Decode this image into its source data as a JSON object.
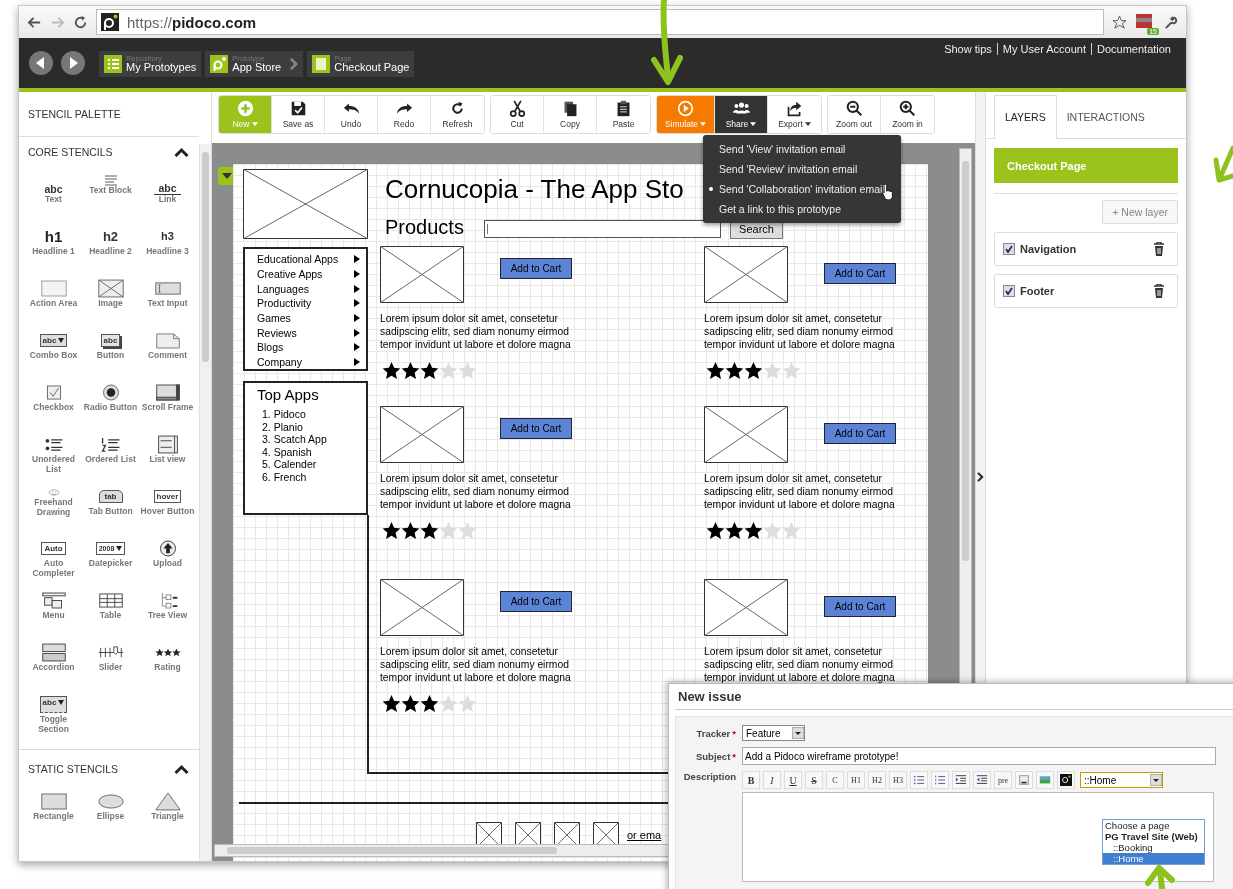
{
  "browser": {
    "url": "https://**pidoco.com**",
    "badge": "15"
  },
  "header": {
    "breadcrumbs": [
      {
        "caption": "Repository",
        "label": "My Prototypes"
      },
      {
        "caption": "Prototype",
        "label": "App Store"
      },
      {
        "caption": "Page",
        "label": "Checkout Page"
      }
    ],
    "links": [
      "Show tips",
      "My User Account",
      "Documentation"
    ]
  },
  "palette": {
    "title": "STENCIL PALETTE",
    "sections": [
      {
        "title": "CORE STENCILS",
        "expanded": true,
        "items": [
          {
            "label": "Text",
            "kind": "text",
            "glyph": "abc"
          },
          {
            "label": "Text Block",
            "kind": "textblock"
          },
          {
            "label": "Link",
            "kind": "link",
            "glyph": "abc"
          },
          {
            "label": "Headline 1",
            "kind": "h1",
            "glyph": "h1"
          },
          {
            "label": "Headline 2",
            "kind": "h2",
            "glyph": "h2"
          },
          {
            "label": "Headline 3",
            "kind": "h3",
            "glyph": "h3"
          },
          {
            "label": "Action Area",
            "kind": "area"
          },
          {
            "label": "Image",
            "kind": "image"
          },
          {
            "label": "Text Input",
            "kind": "input"
          },
          {
            "label": "Combo Box",
            "kind": "combo",
            "glyph": "abc"
          },
          {
            "label": "Button",
            "kind": "button",
            "glyph": "abc"
          },
          {
            "label": "Comment",
            "kind": "comment"
          },
          {
            "label": "Checkbox",
            "kind": "checkbox"
          },
          {
            "label": "Radio Button",
            "kind": "radio"
          },
          {
            "label": "Scroll Frame",
            "kind": "scroll"
          },
          {
            "label": "Unordered List",
            "kind": "ulist"
          },
          {
            "label": "Ordered List",
            "kind": "olist"
          },
          {
            "label": "List view",
            "kind": "listview"
          },
          {
            "label": "Freehand Drawing",
            "kind": "freehand"
          },
          {
            "label": "Tab Button",
            "kind": "tab",
            "glyph": "tab"
          },
          {
            "label": "Hover Button",
            "kind": "hover",
            "glyph": "hover"
          },
          {
            "label": "Auto Completer",
            "kind": "auto",
            "glyph": "Auto"
          },
          {
            "label": "Datepicker",
            "kind": "datepicker",
            "glyph": "2008"
          },
          {
            "label": "Upload",
            "kind": "upload"
          },
          {
            "label": "Menu",
            "kind": "menu"
          },
          {
            "label": "Table",
            "kind": "table"
          },
          {
            "label": "Tree View",
            "kind": "tree"
          },
          {
            "label": "Accordion",
            "kind": "accordion"
          },
          {
            "label": "Slider",
            "kind": "slider"
          },
          {
            "label": "Rating",
            "kind": "rating"
          },
          {
            "label": "Toggle Section",
            "kind": "toggle",
            "glyph": "abc"
          }
        ]
      },
      {
        "title": "STATIC STENCILS",
        "expanded": true,
        "items": [
          {
            "label": "Rectangle",
            "kind": "rect"
          },
          {
            "label": "Ellipse",
            "kind": "ellipse"
          },
          {
            "label": "Triangle",
            "kind": "triangle"
          }
        ]
      }
    ]
  },
  "toolbar": {
    "groups": [
      [
        {
          "label": "New",
          "dropdown": true,
          "selected": false
        },
        {
          "label": "Save as",
          "dropdown": false,
          "selected": false
        },
        {
          "label": "Undo",
          "dropdown": false,
          "selected": false
        },
        {
          "label": "Redo",
          "dropdown": false,
          "selected": false
        },
        {
          "label": "Refresh",
          "dropdown": false,
          "selected": false
        }
      ],
      [
        {
          "label": "Cut",
          "dropdown": false,
          "selected": false
        },
        {
          "label": "Copy",
          "dropdown": false,
          "selected": false
        },
        {
          "label": "Paste",
          "dropdown": false,
          "selected": false
        }
      ],
      [
        {
          "label": "Simulate",
          "dropdown": true,
          "selected": false
        },
        {
          "label": "Share",
          "dropdown": true,
          "selected": true
        },
        {
          "label": "Export",
          "dropdown": true,
          "selected": false
        }
      ],
      [
        {
          "label": "Zoom out",
          "dropdown": false,
          "selected": false
        },
        {
          "label": "Zoom in",
          "dropdown": false,
          "selected": false
        }
      ]
    ]
  },
  "share_menu": [
    {
      "label": "Send 'View' invitation email",
      "selected": false
    },
    {
      "label": "Send 'Review' invitation email",
      "selected": false
    },
    {
      "label": "Send 'Collaboration' invitation email",
      "selected": true
    },
    {
      "label": "Get a link to this prototype",
      "selected": false
    }
  ],
  "canvas": {
    "title": "Cornucopia - The App Sto",
    "products_heading": "Products",
    "search_button": "Search",
    "nav_menu": [
      "Educational Apps",
      "Creative Apps",
      "Languages",
      "Productivity",
      "Games",
      "Reviews",
      "Blogs",
      "Company"
    ],
    "top_apps": {
      "title": "Top Apps",
      "items": [
        {
          "number": "1.",
          "name": "Pidoco"
        },
        {
          "number": "2.",
          "name": "Planio"
        },
        {
          "number": "3.",
          "name": "Scatch App"
        },
        {
          "number": "4.",
          "name": "Spanish"
        },
        {
          "number": "5.",
          "name": "Calender"
        },
        {
          "number": "6.",
          "name": "French"
        }
      ]
    },
    "products": [
      {
        "button": "Add to Cart",
        "text": "Lorem ipsum dolor sit amet, consetetur sadipscing elitr, sed diam nonumy eirmod tempor invidunt ut labore et dolore magna",
        "stars": 3
      },
      {
        "button": "Add to Cart",
        "text": "Lorem ipsum dolor sit amet, consetetur sadipscing elitr, sed diam nonumy eirmod tempor invidunt ut labore et dolore magna",
        "stars": 3
      },
      {
        "button": "Add to Cart",
        "text": "Lorem ipsum dolor sit amet, consetetur sadipscing elitr, sed diam nonumy eirmod tempor invidunt ut labore et dolore magna",
        "stars": 3
      },
      {
        "button": "Add to Cart",
        "text": "Lorem ipsum dolor sit amet, consetetur sadipscing elitr, sed diam nonumy eirmod tempor invidunt ut labore et dolore magna",
        "stars": 3
      },
      {
        "button": "Add to Cart",
        "text": "Lorem ipsum dolor sit amet, consetetur sadipscing elitr, sed diam nonumy eirmod tempor invidunt ut labore et dolore magna",
        "stars": 3
      },
      {
        "button": "Add to Cart",
        "text": "Lorem ipsum dolor sit amet, consetetur sadipscing elitr, sed diam nonumy eirmod tempor invidunt ut labore et dolore magna"
      }
    ],
    "footer_text": "or ema"
  },
  "right_panel": {
    "tabs": [
      {
        "label": "LAYERS",
        "selected": true
      },
      {
        "label": "INTERACTIONS",
        "selected": false
      }
    ],
    "page": "Checkout Page",
    "new_layer": "+ New layer",
    "layers": [
      {
        "name": "Navigation",
        "checked": true
      },
      {
        "name": "Footer",
        "checked": true
      }
    ]
  },
  "issue_dialog": {
    "title": "New issue",
    "required_mark": "*",
    "tracker_label": "Tracker",
    "tracker": "Feature",
    "subject_label": "Subject",
    "subject": "Add a Pidoco wireframe prototype!",
    "description_label": "Description",
    "editor_buttons": [
      {
        "kind": "bold",
        "label": "B"
      },
      {
        "kind": "italic",
        "label": "I"
      },
      {
        "kind": "underline",
        "label": "U"
      },
      {
        "kind": "strike",
        "label": "S"
      },
      {
        "kind": "text",
        "label": "C"
      },
      {
        "kind": "text",
        "label": "H1"
      },
      {
        "kind": "text",
        "label": "H2"
      },
      {
        "kind": "text",
        "label": "H3"
      },
      {
        "kind": "bullets"
      },
      {
        "kind": "numbers"
      },
      {
        "kind": "indent"
      },
      {
        "kind": "outdent"
      },
      {
        "kind": "text",
        "label": "pre"
      },
      {
        "kind": "link"
      },
      {
        "kind": "image"
      },
      {
        "kind": "logo"
      }
    ],
    "page_select": {
      "value": "::Home",
      "options": [
        {
          "label": "Choose a page",
          "kind": "plain",
          "selected": false
        },
        {
          "label": "PG Travel Site (Web)",
          "kind": "group",
          "selected": false
        },
        {
          "label": "::Booking",
          "kind": "option",
          "selected": false
        },
        {
          "label": "::Home",
          "kind": "option",
          "selected": true
        }
      ]
    }
  }
}
